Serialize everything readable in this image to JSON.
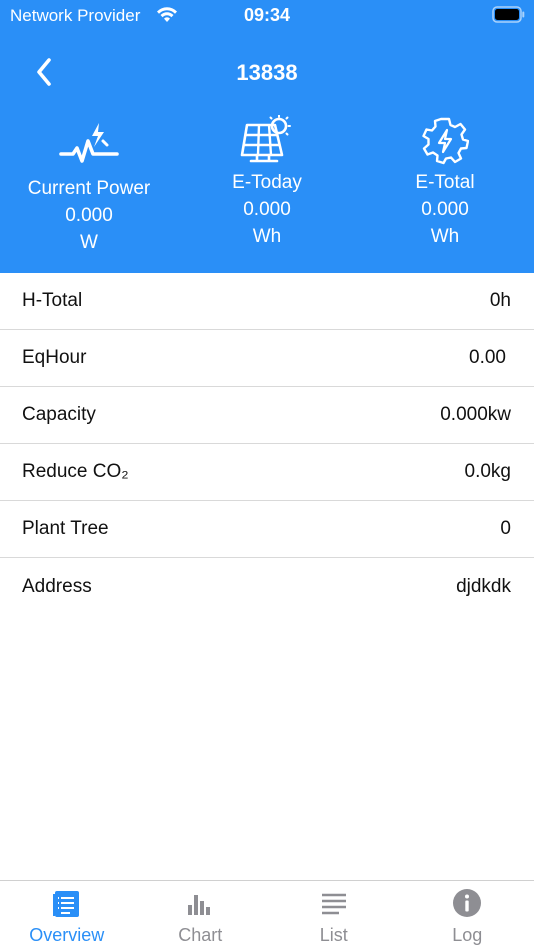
{
  "status_bar": {
    "carrier": "Network Provider",
    "time": "09:34"
  },
  "nav": {
    "title": "13838",
    "back_icon": "chevron-left-icon"
  },
  "stats": [
    {
      "icon": "power-pulse-icon",
      "label": "Current Power",
      "value": "0.000",
      "unit": "W"
    },
    {
      "icon": "solar-panel-icon",
      "label": "E-Today",
      "value": "0.000",
      "unit": "Wh"
    },
    {
      "icon": "gear-bolt-icon",
      "label": "E-Total",
      "value": "0.000",
      "unit": "Wh"
    }
  ],
  "details": [
    {
      "label": "H-Total",
      "value": "0h"
    },
    {
      "label": "EqHour",
      "value": "0.00 "
    },
    {
      "label": "Capacity",
      "value": "0.000kw"
    },
    {
      "label": "Reduce CO₂",
      "value": "0.0kg"
    },
    {
      "label": "Plant Tree",
      "value": "0"
    },
    {
      "label": "Address",
      "value": "djdkdk"
    }
  ],
  "tabs": [
    {
      "label": "Overview",
      "icon": "document-list-icon",
      "active": true
    },
    {
      "label": "Chart",
      "icon": "bar-chart-icon",
      "active": false
    },
    {
      "label": "List",
      "icon": "list-lines-icon",
      "active": false
    },
    {
      "label": "Log",
      "icon": "info-icon",
      "active": false
    }
  ],
  "colors": {
    "primary": "#2a8ff7",
    "tab_inactive": "#8e8e93",
    "text": "#111111",
    "divider": "#d9d9d9"
  }
}
